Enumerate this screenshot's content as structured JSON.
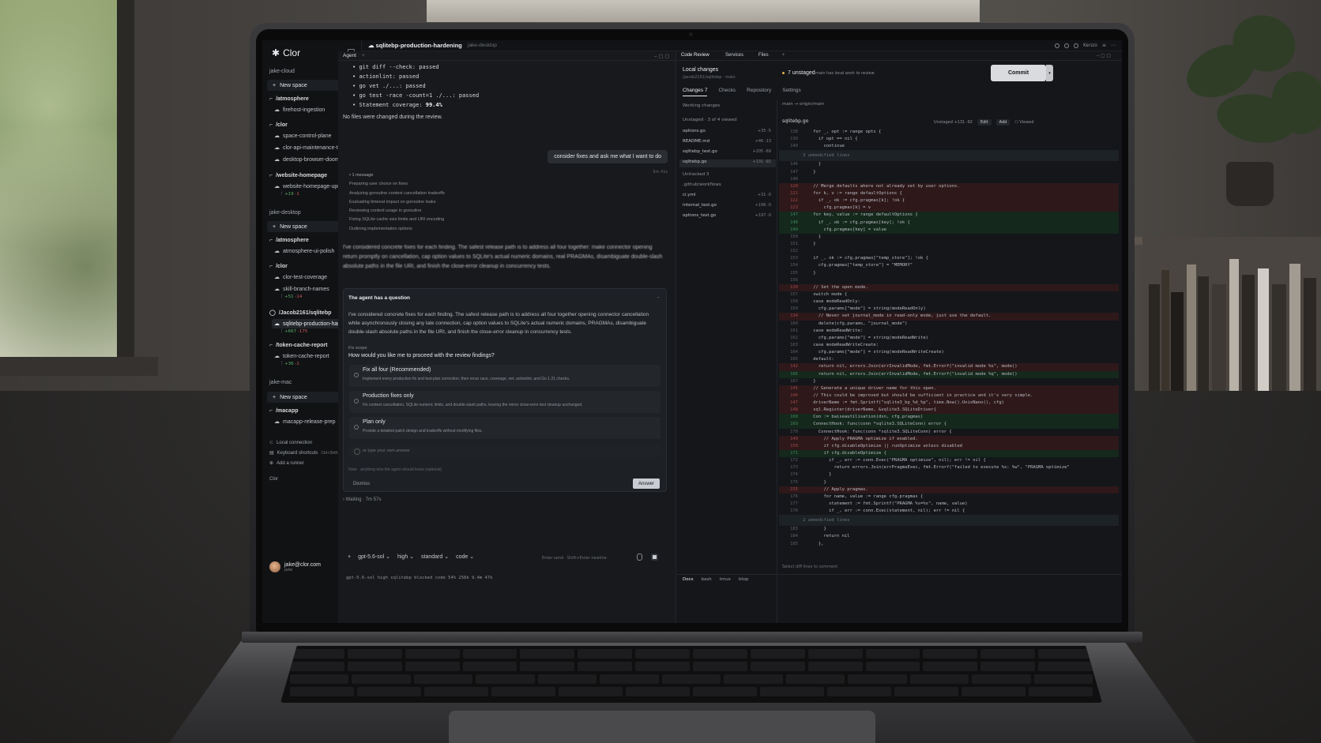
{
  "app": {
    "brand": "Clor",
    "title": "sqlitebp-production-hardening",
    "subtitle": "jake-desktop",
    "top_right": "Kenzo"
  },
  "sidebar": {
    "sections": [
      {
        "name": "jake-cloud",
        "new_space": "New space"
      },
      {
        "name": "jake-desktop",
        "new_space": "New space"
      },
      {
        "name": "jake-mac",
        "new_space": "New space"
      }
    ],
    "groups": [
      {
        "label": "/atmosphere",
        "items": [
          {
            "label": "firehost-ingestion"
          }
        ]
      },
      {
        "label": "/clor",
        "items": [
          {
            "label": "space-control-plane"
          },
          {
            "label": "clor-api-maintenance-tasks"
          },
          {
            "label": "desktop-browser-doom"
          }
        ]
      },
      {
        "label": "/website-homepage",
        "items": [
          {
            "label": "website-homepage-update",
            "add": "+19",
            "del": "-1"
          }
        ]
      },
      {
        "label": "/atmosphere",
        "items": [
          {
            "label": "atmosphere-ui-polish"
          }
        ]
      },
      {
        "label": "/clor",
        "items": [
          {
            "label": "clor-test-coverage"
          },
          {
            "label": "skill-branch-names",
            "add": "+51",
            "del": "-14"
          }
        ]
      },
      {
        "label": "/Jacob2161/sqlitebp",
        "items": [
          {
            "label": "sqlitebp-production-har...",
            "add": "+667",
            "del": "-175"
          }
        ]
      },
      {
        "label": "/token-cache-report",
        "items": [
          {
            "label": "token-cache-report",
            "add": "+36",
            "del": "-1"
          }
        ]
      },
      {
        "label": "/macapp",
        "items": [
          {
            "label": "macapp-release-prep"
          }
        ]
      }
    ],
    "footer": {
      "local_connection": "Local connection",
      "keyboard_shortcuts": "Keyboard shortcuts",
      "shortcut_keys": "Ctrl+Shift+K",
      "add_runner": "Add a runner",
      "clor": "Clor"
    },
    "user": {
      "email": "jake@clor.com",
      "sub": "jake"
    }
  },
  "agent": {
    "tab": "Agent",
    "code_lines": [
      "git diff --check: passed",
      "actionlint: passed",
      "go vet ./...: passed",
      "go test -race -count=1 ./...: passed",
      "Statement coverage: 99.4%"
    ],
    "coverage_label": "Statement coverage: ",
    "coverage_value": "99.4%",
    "no_changes": "No files were changed during the review.",
    "user_message": "consider fixes and ask me what I want to do",
    "user_message_time": "9m 41s",
    "steps_head": "1 message",
    "steps": [
      "Preparing user choice on fixes",
      "Analyzing goroutine context cancellation tradeoffs",
      "Evaluating timeout impact on goroutine leaks",
      "Reviewing context usage in goroutine",
      "Fixing SQLite cache size limits and URI encoding",
      "Outlining implementation options"
    ],
    "reply": "I've considered concrete fixes for each finding. The safest release path is to address all four together: make connector opening return promptly on cancellation, cap option values to SQLite's actual numeric domains, real PRAGMAs, disambiguate double-slash absolute paths in the file URI, and finish the close-error cleanup in concurrency tests.",
    "question": {
      "title": "The agent has a question",
      "body": "I've considered concrete fixes for each finding. The safest release path is to address all four together opening connector cancellation while asynchronously closing any late connection, cap option values to SQLite's actual numeric domains, PRAGMAs, disambiguate double-slash absolute paths in the file URI, and finish the close-error cleanup in concurrency tests.",
      "scope": "Fix scope",
      "ask": "How would you like me to proceed with the review findings?",
      "options": [
        {
          "label": "Fix all four (Recommended)",
          "desc": "Implement every production fix and test-plan correction, then rerun race, coverage, vet, actionlint, and Go 1.21 checks."
        },
        {
          "label": "Production fixes only",
          "desc": "Fix context cancellation, SQLite numeric limits, and double-slash paths, leaving the minor close-error test cleanup unchanged."
        },
        {
          "label": "Plan only",
          "desc": "Provide a detailed patch design and tradeoffs without modifying files."
        }
      ],
      "own_answer": "or type your own answer",
      "note": "Note · anything else the agent should know (optional)",
      "dismiss": "Dismiss",
      "answer": "Answer"
    },
    "waiting": "Waiting · 7m 57s",
    "composer": {
      "model": "gpt-5.6-sol",
      "effort": "high",
      "mode": "standard",
      "tool": "code",
      "hint": "Enter send · Shift+Enter newline"
    },
    "statusline": "gpt-5.6-sol high  sqlitebp  blocked  code  54%  258k  9.4m  47k"
  },
  "review": {
    "tabs": [
      "Code Review",
      "Services",
      "Files"
    ],
    "local_changes": "Local changes",
    "repo_path": "/jacob2161/sqlitebp · main",
    "unstaged": "7 unstaged",
    "unstaged_note": "main has local work to review",
    "commit": "Commit",
    "sub_tabs": [
      {
        "label": "Changes 7"
      },
      {
        "label": "Checks"
      },
      {
        "label": "Repository"
      },
      {
        "label": "Settings"
      }
    ],
    "working_changes": "Working changes",
    "branch": "main → origin/main",
    "viewed": "3 of 4 viewed",
    "files": [
      {
        "label": "Unstaged",
        "n": "",
        "hd": true
      },
      {
        "label": "options.go",
        "n": "+35 -5"
      },
      {
        "label": "README.md",
        "n": "+46 -13"
      },
      {
        "label": "sqlitebp_test.go",
        "n": "+205 -69"
      },
      {
        "label": "sqlitebp.go",
        "n": "+131 -92",
        "active": true
      },
      {
        "label": "Untracked  3",
        "n": "",
        "hd": true
      },
      {
        "label": ".github/workflows",
        "n": "",
        "hd": true
      },
      {
        "label": "ci.yml",
        "n": "+31 -0"
      },
      {
        "label": "internal_test.go",
        "n": "+196 -0"
      },
      {
        "label": "options_test.go",
        "n": "+197 -0"
      }
    ],
    "diff_file": "sqlitebp.go",
    "diff_meta": "Unstaged +131 -92",
    "edit": "Edit",
    "add": "Add",
    "viewed_label": "Viewed",
    "diff_lines": [
      {
        "n": "138",
        "t": "    for _, opt := range opts {",
        "k": ""
      },
      {
        "n": "139",
        "t": "      if opt == nil {",
        "k": ""
      },
      {
        "n": "140",
        "t": "        continue",
        "k": ""
      },
      {
        "n": "",
        "t": "3 unmodified lines",
        "k": "fold"
      },
      {
        "n": "146",
        "t": "      }",
        "k": ""
      },
      {
        "n": "147",
        "t": "    }",
        "k": ""
      },
      {
        "n": "148",
        "t": "",
        "k": ""
      },
      {
        "n": "120",
        "t": "    // Merge defaults where not already set by user options.",
        "k": "del"
      },
      {
        "n": "121",
        "t": "    for k, v := range defaultOptions {",
        "k": "del"
      },
      {
        "n": "122",
        "t": "      if _, ok := cfg.pragmas[k]; !ok {",
        "k": "del"
      },
      {
        "n": "123",
        "t": "        cfg.pragmas[k] = v",
        "k": "del"
      },
      {
        "n": "147",
        "t": "    for key, value := range defaultOptions {",
        "k": "add"
      },
      {
        "n": "148",
        "t": "      if _, ok := cfg.pragmas[key]; !ok {",
        "k": "add"
      },
      {
        "n": "149",
        "t": "        cfg.pragmas[key] = value",
        "k": "add"
      },
      {
        "n": "150",
        "t": "      }",
        "k": ""
      },
      {
        "n": "151",
        "t": "    }",
        "k": ""
      },
      {
        "n": "152",
        "t": "",
        "k": ""
      },
      {
        "n": "153",
        "t": "    if _, ok := cfg.pragmas[\"temp_store\"]; !ok {",
        "k": ""
      },
      {
        "n": "154",
        "t": "      cfg.pragmas[\"temp_store\"] = \"MEMORY\"",
        "k": ""
      },
      {
        "n": "155",
        "t": "    }",
        "k": ""
      },
      {
        "n": "156",
        "t": "",
        "k": ""
      },
      {
        "n": "130",
        "t": "    // Set the open mode.",
        "k": "del"
      },
      {
        "n": "157",
        "t": "    switch mode {",
        "k": ""
      },
      {
        "n": "158",
        "t": "    case modeReadOnly:",
        "k": ""
      },
      {
        "n": "159",
        "t": "      cfg.params[\"mode\"] = string(modeReadOnly)",
        "k": ""
      },
      {
        "n": "134",
        "t": "      // Never set journal_mode in read-only mode, just use the default.",
        "k": "del"
      },
      {
        "n": "160",
        "t": "      delete(cfg.params, \"journal_mode\")",
        "k": ""
      },
      {
        "n": "161",
        "t": "    case modeReadWrite:",
        "k": ""
      },
      {
        "n": "162",
        "t": "      cfg.params[\"mode\"] = string(modeReadWrite)",
        "k": ""
      },
      {
        "n": "163",
        "t": "    case modeReadWriteCreate:",
        "k": ""
      },
      {
        "n": "164",
        "t": "      cfg.params[\"mode\"] = string(modeReadWriteCreate)",
        "k": ""
      },
      {
        "n": "165",
        "t": "    default:",
        "k": ""
      },
      {
        "n": "142",
        "t": "      return nil, errors.Join(errInvalidMode, fmt.Errorf(\"invalid mode %s\", mode))",
        "k": "del"
      },
      {
        "n": "166",
        "t": "      return nil, errors.Join(errInvalidMode, fmt.Errorf(\"invalid mode %q\", mode))",
        "k": "add"
      },
      {
        "n": "167",
        "t": "    }",
        "k": ""
      },
      {
        "n": "145",
        "t": "    // Generate a unique driver name for this open.",
        "k": "del"
      },
      {
        "n": "146",
        "t": "    // This could be improved but should be sufficient in practice and it's very simple.",
        "k": "del"
      },
      {
        "n": "147",
        "t": "    driverName := fmt.Sprintf(\"sqlite3_bp_%d_%p\", time.Now().UnixNano(), cfg)",
        "k": "del"
      },
      {
        "n": "148",
        "t": "    sql.Register(driverName, &sqlite3.SQLiteDriver{",
        "k": "del"
      },
      {
        "n": "168",
        "t": "    Con := baiseautilisation(dsn, cfg.pragmas)",
        "k": "add"
      },
      {
        "n": "169",
        "t": "    ConnectHook: func(conn *sqlite3.SQLiteConn) error {",
        "k": "add"
      },
      {
        "n": "170",
        "t": "      ConnectHook: func(conn *sqlite3.SQLiteConn) error {",
        "k": ""
      },
      {
        "n": "149",
        "t": "        // Apply PRAGMA optimize if enabled.",
        "k": "del"
      },
      {
        "n": "150",
        "t": "        if cfg.disableOptimize || runOptimize unless disabled",
        "k": "del"
      },
      {
        "n": "171",
        "t": "        if cfg.disableOptimize {",
        "k": "add"
      },
      {
        "n": "172",
        "t": "          if _, err := conn.Exec(\"PRAGMA optimize\", nil); err != nil {",
        "k": ""
      },
      {
        "n": "173",
        "t": "            return errors.Join(errPragmaExec, fmt.Errorf(\"failed to execute %s: %w\", \"PRAGMA optimize\"",
        "k": ""
      },
      {
        "n": "174",
        "t": "          }",
        "k": ""
      },
      {
        "n": "175",
        "t": "        }",
        "k": ""
      },
      {
        "n": "155",
        "t": "        // Apply pragmas.",
        "k": "del"
      },
      {
        "n": "176",
        "t": "        for name, value := range cfg.pragmas {",
        "k": ""
      },
      {
        "n": "177",
        "t": "          statement := fmt.Sprintf(\"PRAGMA %s=%s\", name, value)",
        "k": ""
      },
      {
        "n": "178",
        "t": "          if _, err := conn.Exec(statement, nil); err != nil {",
        "k": ""
      },
      {
        "n": "",
        "t": "2 unmodified lines",
        "k": "fold"
      },
      {
        "n": "183",
        "t": "        }",
        "k": ""
      },
      {
        "n": "184",
        "t": "        return nil",
        "k": ""
      },
      {
        "n": "185",
        "t": "      },",
        "k": ""
      }
    ],
    "select_hint": "Select diff lines to comment",
    "bottom_tabs": [
      "Docs",
      "bash",
      "tmux",
      "btop"
    ]
  },
  "colors": {
    "accent": "#e0b04a",
    "add": "#58b06b",
    "del": "#d05a5a",
    "bg": "#15171a"
  }
}
